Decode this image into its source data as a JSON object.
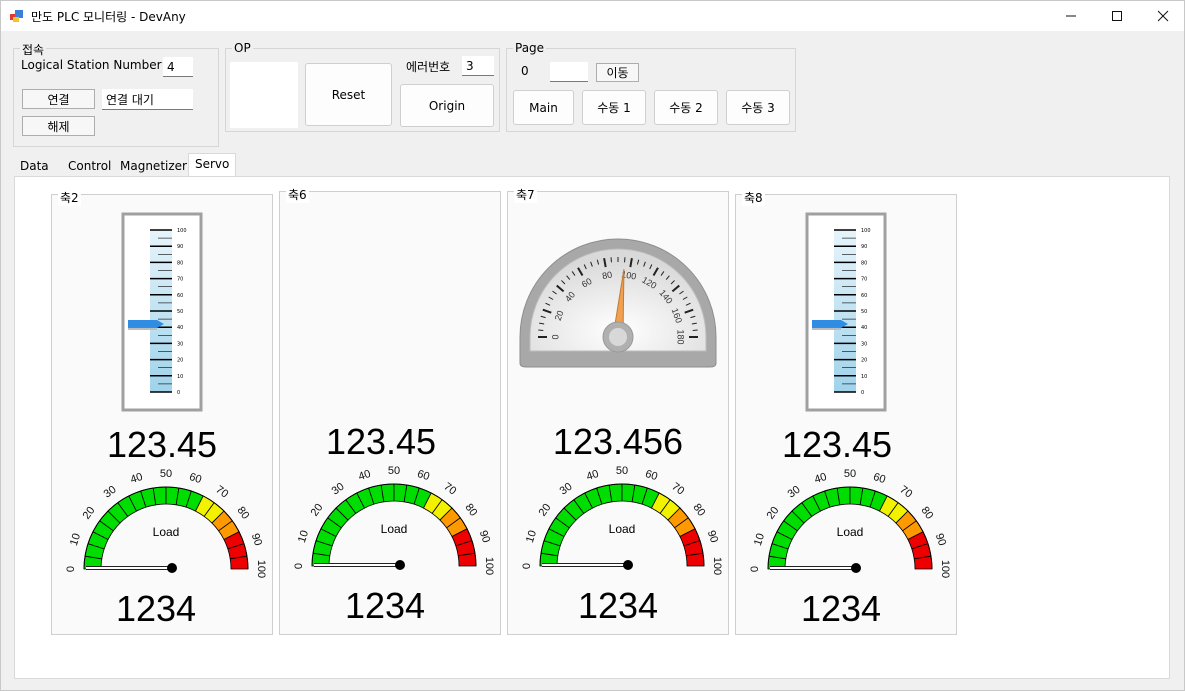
{
  "window": {
    "title": "만도 PLC 모니터링 - DevAny",
    "minimize_icon": "minimize-icon",
    "maximize_icon": "maximize-icon",
    "close_icon": "close-icon"
  },
  "connection": {
    "label": "접속",
    "station_label": "Logical Station Number",
    "station_value": "4",
    "connect_label": "연결",
    "status_value": "연결 대기",
    "disconnect_label": "해제"
  },
  "op": {
    "label": "OP",
    "reset_label": "Reset",
    "error_label": "에러번호",
    "error_value": "3",
    "origin_label": "Origin"
  },
  "page": {
    "label": "Page",
    "current": "0",
    "input_value": "",
    "move_label": "이동",
    "buttons": [
      "Main",
      "수동 1",
      "수동 2",
      "수동 3"
    ]
  },
  "tabs": [
    "Data",
    "Control",
    "Magnetizer",
    "Servo"
  ],
  "active_tab": "Servo",
  "axes": [
    {
      "label": "축2",
      "meter": "linear",
      "meter_value": 42,
      "position": "123.45",
      "load_value": 0,
      "load_text": "1234"
    },
    {
      "label": "축6",
      "meter": "none",
      "meter_value": null,
      "position": "123.45",
      "load_value": 0,
      "load_text": "1234"
    },
    {
      "label": "축7",
      "meter": "speedometer",
      "meter_value": 95,
      "position": "123.456",
      "load_value": 0,
      "load_text": "1234"
    },
    {
      "label": "축8",
      "meter": "linear",
      "meter_value": 42,
      "position": "123.45",
      "load_value": 0,
      "load_text": "1234"
    }
  ],
  "linear_scale": [
    "100",
    "90",
    "80",
    "70",
    "60",
    "50",
    "40",
    "30",
    "20",
    "10",
    "0"
  ],
  "load_gauge": {
    "title": "Load",
    "ticks": [
      "0",
      "10",
      "20",
      "30",
      "40",
      "50",
      "60",
      "70",
      "80",
      "90",
      "100"
    ]
  },
  "speedometer": {
    "ticks": [
      "0",
      "20",
      "40",
      "60",
      "80",
      "100",
      "120",
      "140",
      "160",
      "180"
    ]
  },
  "colors": {
    "green": "#00dd00",
    "yellow": "#f2f200",
    "orange": "#ff9900",
    "red": "#ee0000",
    "linear_fill": "#9fd3ea",
    "pointer": "#2f8de4",
    "needle": "#f0a050"
  }
}
